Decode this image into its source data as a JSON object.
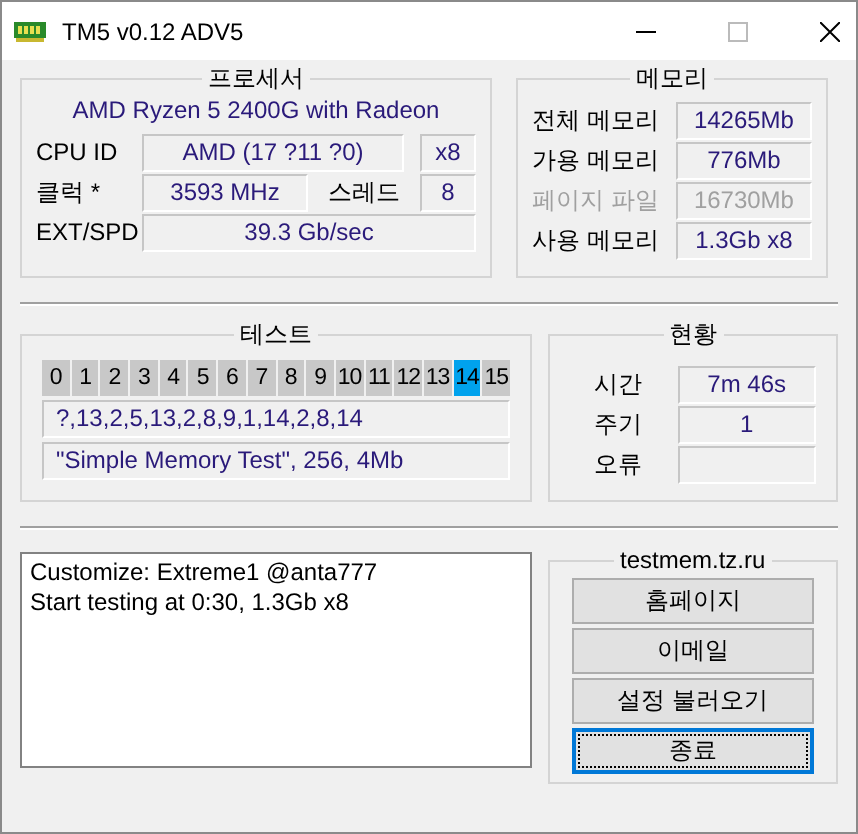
{
  "window": {
    "title": "TM5 v0.12 ADV5"
  },
  "processor": {
    "title": "프로세서",
    "name": "AMD Ryzen 5 2400G with Radeon",
    "cpu_id": {
      "label": "CPU ID",
      "value": "AMD  (17 ?11 ?0)",
      "cores": "x8"
    },
    "clock": {
      "label": "클럭 *",
      "value": "3593 MHz",
      "threads_label": "스레드",
      "threads": "8"
    },
    "ext": {
      "label": "EXT/SPD",
      "value": "39.3 Gb/sec"
    }
  },
  "memory": {
    "title": "메모리",
    "rows": [
      {
        "label": "전체 메모리",
        "value": "14265Mb",
        "disabled": false
      },
      {
        "label": "가용 메모리",
        "value": "776Mb",
        "disabled": false
      },
      {
        "label": "페이지 파일",
        "value": "16730Mb",
        "disabled": true
      },
      {
        "label": "사용 메모리",
        "value": "1.3Gb x8",
        "disabled": false
      }
    ]
  },
  "test": {
    "title": "테스트",
    "cells": [
      {
        "label": "0",
        "selected": false
      },
      {
        "label": "1",
        "selected": false
      },
      {
        "label": "2",
        "selected": false
      },
      {
        "label": "3",
        "selected": false
      },
      {
        "label": "4",
        "selected": false
      },
      {
        "label": "5",
        "selected": false
      },
      {
        "label": "6",
        "selected": false
      },
      {
        "label": "7",
        "selected": false
      },
      {
        "label": "8",
        "selected": false
      },
      {
        "label": "9",
        "selected": false
      },
      {
        "label": "10",
        "selected": false
      },
      {
        "label": "11",
        "selected": false
      },
      {
        "label": "12",
        "selected": false
      },
      {
        "label": "13",
        "selected": false
      },
      {
        "label": "14",
        "selected": true
      },
      {
        "label": "15",
        "selected": false
      }
    ],
    "sequence": "?,13,2,5,13,2,8,9,1,14,2,8,14",
    "description": "\"Simple Memory Test\", 256, 4Mb"
  },
  "status": {
    "title": "현황",
    "rows": [
      {
        "label": "시간",
        "value": "7m 46s"
      },
      {
        "label": "주기",
        "value": "1"
      },
      {
        "label": "오류"
      }
    ]
  },
  "log": {
    "lines": [
      "Customize: Extreme1 @anta777",
      "Start testing at 0:30, 1.3Gb x8"
    ]
  },
  "links": {
    "title": "testmem.tz.ru",
    "buttons": [
      {
        "label": "홈페이지",
        "focused": false
      },
      {
        "label": "이메일",
        "focused": false
      },
      {
        "label": "설정 불러오기",
        "focused": false
      },
      {
        "label": "종료",
        "focused": true
      }
    ]
  }
}
